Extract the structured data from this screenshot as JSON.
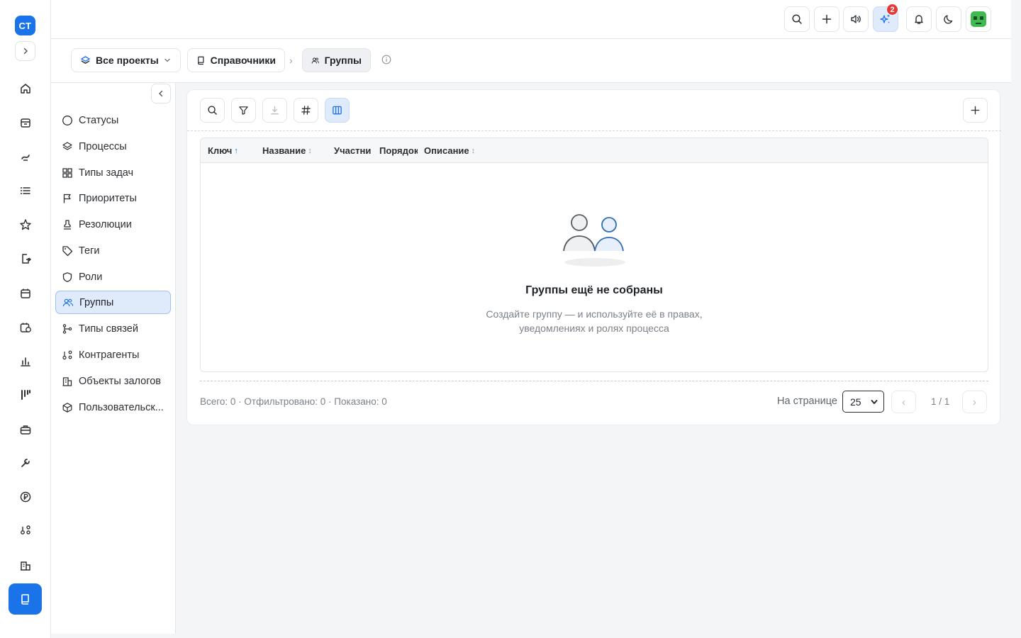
{
  "rail": {
    "logo": "СТ"
  },
  "topbar": {
    "notifications_badge": "2"
  },
  "breadcrumbs": {
    "projects": "Все проекты",
    "directories": "Справочники",
    "current": "Группы",
    "separator": "›"
  },
  "sidebar": {
    "items": [
      {
        "label": "Статусы",
        "icon": "circle-icon"
      },
      {
        "label": "Процессы",
        "icon": "layers-icon"
      },
      {
        "label": "Типы задач",
        "icon": "grid-icon"
      },
      {
        "label": "Приоритеты",
        "icon": "flag-icon"
      },
      {
        "label": "Резолюции",
        "icon": "stamp-icon"
      },
      {
        "label": "Теги",
        "icon": "tag-icon"
      },
      {
        "label": "Роли",
        "icon": "shield-icon"
      },
      {
        "label": "Группы",
        "icon": "users-icon",
        "active": true
      },
      {
        "label": "Типы связей",
        "icon": "git-branch-icon"
      },
      {
        "label": "Контрагенты",
        "icon": "network-icon"
      },
      {
        "label": "Объекты залогов",
        "icon": "building-icon"
      },
      {
        "label": "Пользовательск...",
        "icon": "box-icon"
      }
    ]
  },
  "table": {
    "columns": [
      {
        "label": "Ключ",
        "sort": "↑"
      },
      {
        "label": "Название",
        "sort": "↕"
      },
      {
        "label": "Участники",
        "sort": ""
      },
      {
        "label": "Порядок",
        "sort": ""
      },
      {
        "label": "Описание",
        "sort": "↕"
      }
    ],
    "empty_title": "Группы ещё не собраны",
    "empty_desc": "Создайте группу — и используйте её в правах, уведомлениях и ролях процесса"
  },
  "footer": {
    "summary": "Всего: 0 · Отфильтровано: 0 · Показано: 0",
    "per_page_label": "На странице",
    "per_page_value": "25",
    "page_info": "1 / 1",
    "prev": "‹",
    "next": "›"
  },
  "colors": {
    "accent": "#1a73e8",
    "active_bg": "#dfeafb",
    "badge": "#e53935"
  }
}
